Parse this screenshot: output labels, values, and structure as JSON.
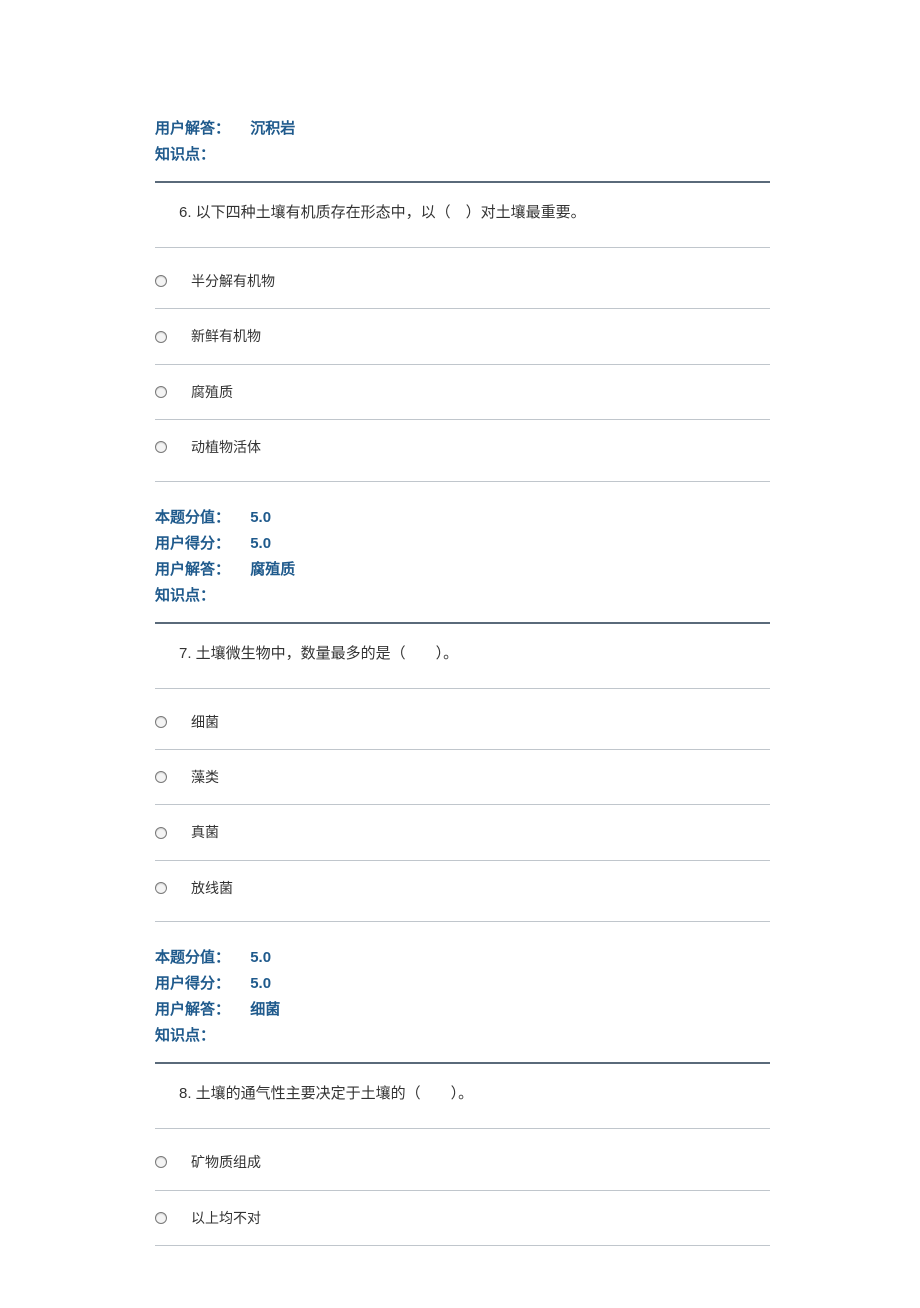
{
  "labels": {
    "user_answer": "用户解答：",
    "knowledge_point": "知识点：",
    "question_score": "本题分值：",
    "user_score": "用户得分："
  },
  "prev_result": {
    "user_answer_value": "沉积岩"
  },
  "q6": {
    "stem": "6.  以下四种土壤有机质存在形态中，以（　）对土壤最重要。",
    "options": [
      "半分解有机物",
      "新鲜有机物",
      "腐殖质",
      "动植物活体"
    ],
    "question_score_value": "5.0",
    "user_score_value": "5.0",
    "user_answer_value": "腐殖质"
  },
  "q7": {
    "stem": "7.  土壤微生物中，数量最多的是（　　）。",
    "options": [
      "细菌",
      "藻类",
      "真菌",
      "放线菌"
    ],
    "question_score_value": "5.0",
    "user_score_value": "5.0",
    "user_answer_value": "细菌"
  },
  "q8": {
    "stem": "8.  土壤的通气性主要决定于土壤的（　　）。",
    "options": [
      "矿物质组成",
      "以上均不对"
    ]
  }
}
